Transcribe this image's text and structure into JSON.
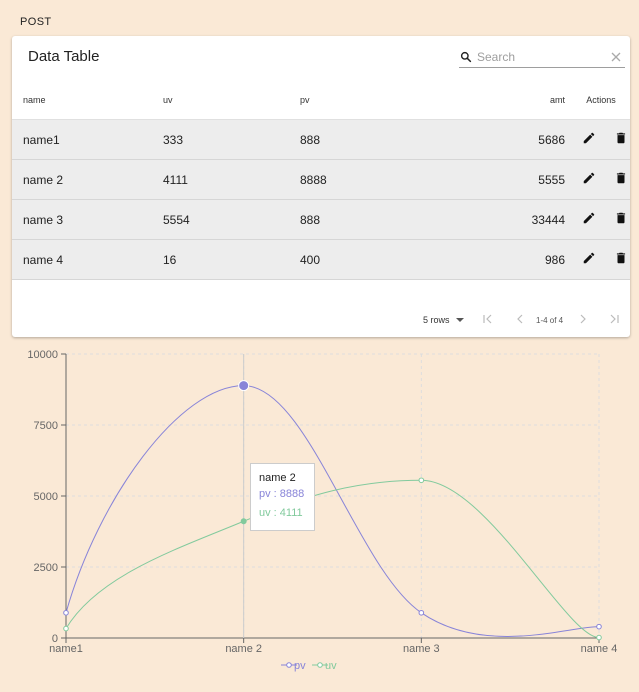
{
  "header": {
    "post_label": "POST"
  },
  "table": {
    "title": "Data Table",
    "search_placeholder": "Search",
    "columns": {
      "name": "name",
      "uv": "uv",
      "pv": "pv",
      "amt": "amt",
      "actions": "Actions"
    },
    "rows": [
      {
        "name": "name1",
        "uv": "333",
        "pv": "888",
        "amt": "5686"
      },
      {
        "name": "name 2",
        "uv": "4111",
        "pv": "8888",
        "amt": "5555"
      },
      {
        "name": "name 3",
        "uv": "5554",
        "pv": "888",
        "amt": "33444"
      },
      {
        "name": "name 4",
        "uv": "16",
        "pv": "400",
        "amt": "986"
      }
    ],
    "pagination": {
      "rows_label": "5 rows",
      "range": "1-4 of 4"
    }
  },
  "chart_data": {
    "type": "line",
    "categories": [
      "name1",
      "name 2",
      "name 3",
      "name 4"
    ],
    "series": [
      {
        "name": "pv",
        "values": [
          888,
          8888,
          888,
          400
        ],
        "color": "#8884d8"
      },
      {
        "name": "uv",
        "values": [
          333,
          4111,
          5554,
          16
        ],
        "color": "#82ca9d"
      }
    ],
    "yticks": [
      "0",
      "2500",
      "5000",
      "7500",
      "10000"
    ],
    "ylim": [
      0,
      10000
    ],
    "grid": true,
    "legend_placement": "bottom-center",
    "tooltip": {
      "title": "name 2",
      "pv": "pv : 8888",
      "uv": "uv : 4111"
    }
  },
  "colors": {
    "background": "#fae9d6",
    "pv": "#8884d8",
    "uv": "#82ca9d"
  }
}
